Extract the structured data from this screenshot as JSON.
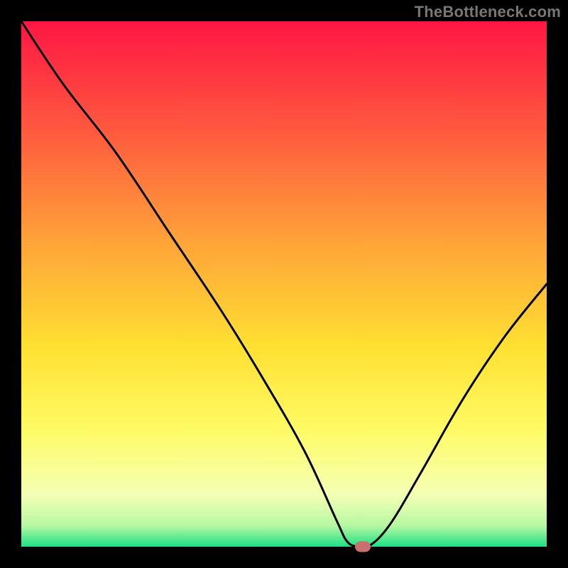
{
  "watermark": "TheBottleneck.com",
  "chart_data": {
    "type": "line",
    "title": "",
    "xlabel": "",
    "ylabel": "",
    "xlim": [
      0,
      100
    ],
    "ylim": [
      0,
      100
    ],
    "grid": false,
    "legend": false,
    "gradient_stops": [
      {
        "offset": 0.0,
        "color": "#ff1644"
      },
      {
        "offset": 0.2,
        "color": "#ff563f"
      },
      {
        "offset": 0.42,
        "color": "#ffa339"
      },
      {
        "offset": 0.62,
        "color": "#ffe032"
      },
      {
        "offset": 0.78,
        "color": "#fffb66"
      },
      {
        "offset": 0.9,
        "color": "#f5ffb5"
      },
      {
        "offset": 0.96,
        "color": "#b7f7a2"
      },
      {
        "offset": 1.0,
        "color": "#1ee085"
      }
    ],
    "series": [
      {
        "name": "bottleneck-curve",
        "x": [
          0,
          8,
          18,
          28,
          38,
          46,
          54,
          60,
          62,
          64,
          66,
          70,
          76,
          84,
          92,
          100
        ],
        "y": [
          100,
          88,
          75,
          60,
          45,
          32,
          18,
          5,
          1,
          0,
          0,
          4,
          14,
          28,
          40,
          50
        ]
      }
    ],
    "marker": {
      "x": 65,
      "y": 0,
      "color": "#c9706e"
    }
  }
}
